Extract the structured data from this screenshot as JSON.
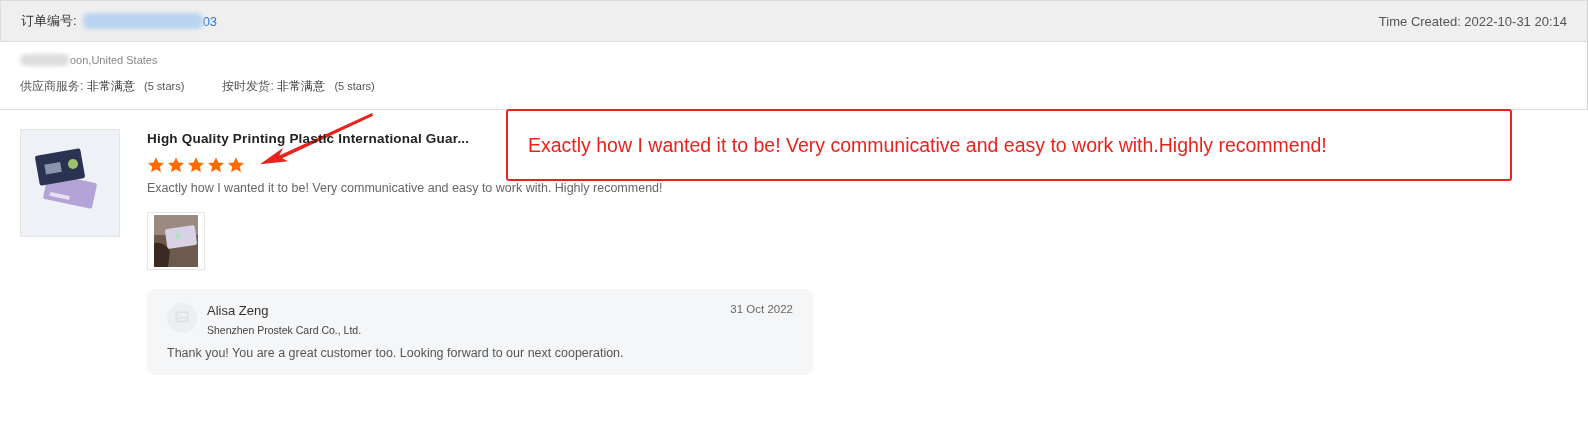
{
  "header": {
    "order_label": "订单编号:",
    "order_number_visible": "03",
    "time_created": "Time Created: 2022-10-31 20:14"
  },
  "buyer": {
    "location_visible": "oon,United States",
    "ratings": [
      {
        "label": "供应商服务:",
        "value": "非常满意",
        "stars_text": "(5 stars)"
      },
      {
        "label": "按时发货:",
        "value": "非常满意",
        "stars_text": "(5 stars)"
      }
    ]
  },
  "review": {
    "product_title": "High Quality Printing Plastic International Guar...",
    "stars": 5,
    "text": "Exactly how I wanted it to be! Very communicative and easy to work with. Highly recommend!",
    "photos": [
      {
        "kind": "picture"
      }
    ]
  },
  "reply": {
    "name": "Alisa Zeng",
    "company": "Shenzhen Prostek Card Co., Ltd.",
    "date": "31 Oct 2022",
    "text": "Thank you! You are a great customer too.  Looking forward to our next cooperation."
  },
  "annotation": {
    "text": "Exactly how I wanted it to be!  Very communicative and easy to work with.Highly recommend!"
  }
}
